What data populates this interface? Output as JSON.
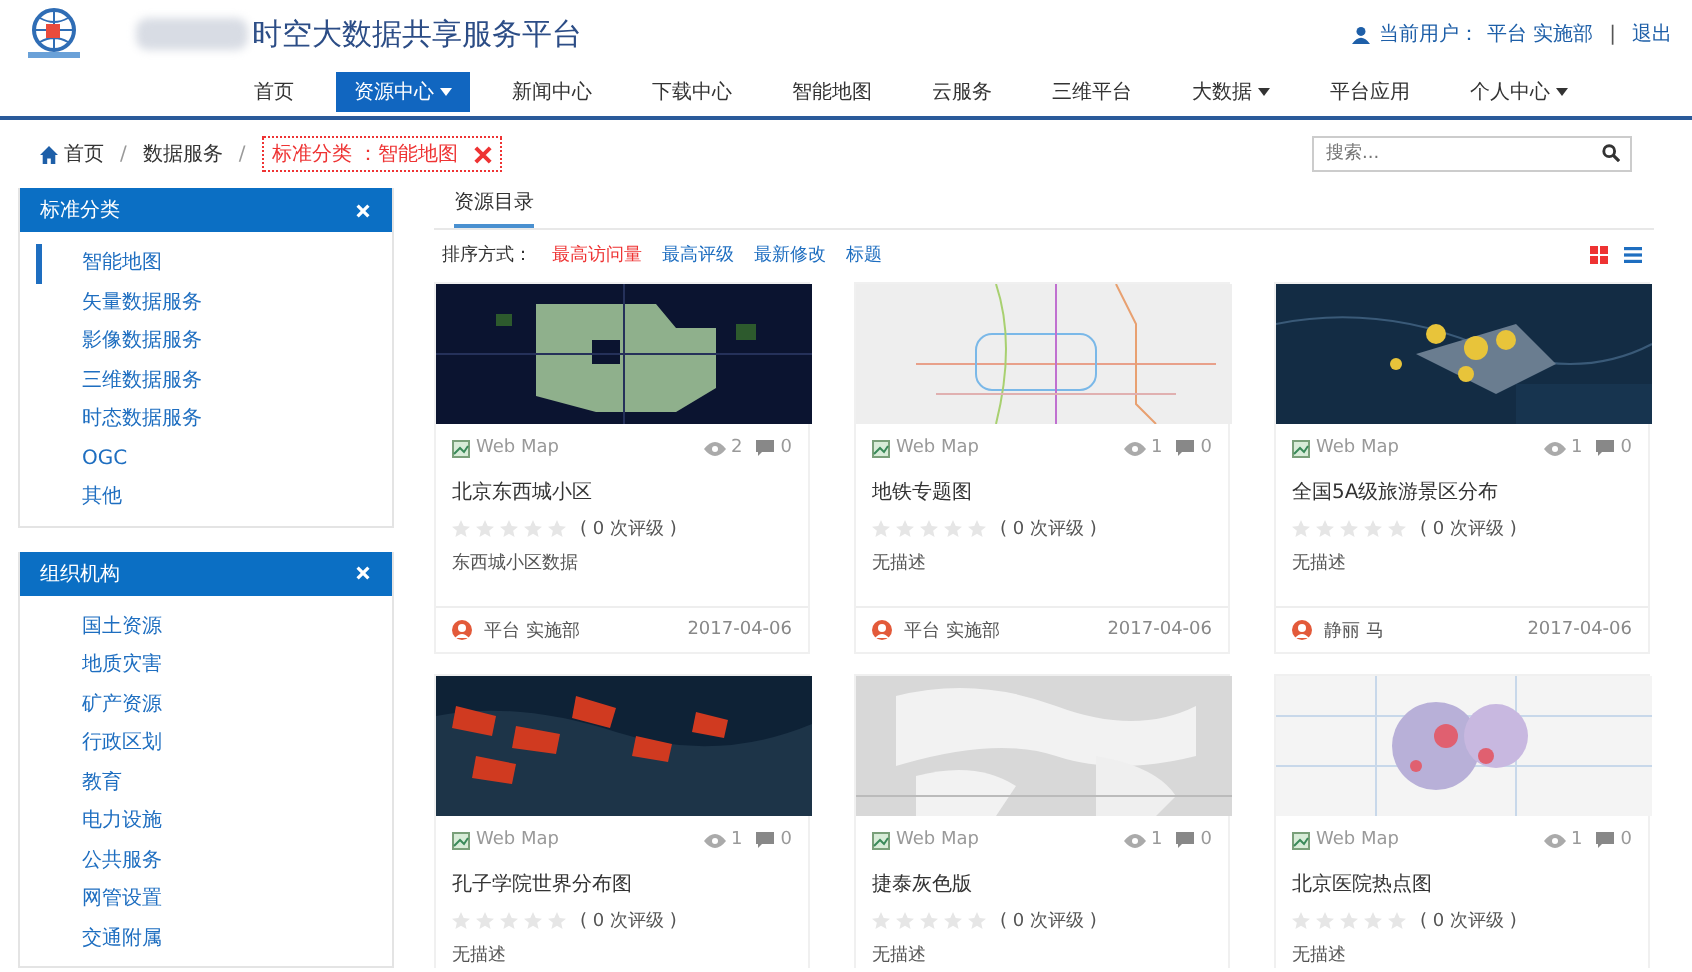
{
  "header": {
    "title": "时空大数据共享服务平台",
    "user_label": "当前用户：",
    "user_name": "平台 实施部",
    "separator": "|",
    "logout": "退出"
  },
  "nav": [
    {
      "label": "首页",
      "selected": false,
      "dropdown": false
    },
    {
      "label": "资源中心",
      "selected": true,
      "dropdown": true
    },
    {
      "label": "新闻中心",
      "selected": false,
      "dropdown": false
    },
    {
      "label": "下载中心",
      "selected": false,
      "dropdown": false
    },
    {
      "label": "智能地图",
      "selected": false,
      "dropdown": false
    },
    {
      "label": "云服务",
      "selected": false,
      "dropdown": false
    },
    {
      "label": "三维平台",
      "selected": false,
      "dropdown": false
    },
    {
      "label": "大数据",
      "selected": false,
      "dropdown": true
    },
    {
      "label": "平台应用",
      "selected": false,
      "dropdown": false
    },
    {
      "label": "个人中心",
      "selected": false,
      "dropdown": true
    }
  ],
  "breadcrumb": {
    "items": [
      "首页",
      "数据服务"
    ],
    "separator": "/",
    "filter": "标准分类 ：智能地图"
  },
  "search": {
    "placeholder": "搜索..."
  },
  "sidebar": [
    {
      "title": "标准分类",
      "items": [
        {
          "label": "智能地图",
          "selected": true
        },
        {
          "label": "矢量数据服务",
          "selected": false
        },
        {
          "label": "影像数据服务",
          "selected": false
        },
        {
          "label": "三维数据服务",
          "selected": false
        },
        {
          "label": "时态数据服务",
          "selected": false
        },
        {
          "label": "OGC",
          "selected": false
        },
        {
          "label": "其他",
          "selected": false
        }
      ]
    },
    {
      "title": "组织机构",
      "items": [
        {
          "label": "国土资源",
          "selected": false
        },
        {
          "label": "地质灾害",
          "selected": false
        },
        {
          "label": "矿产资源",
          "selected": false
        },
        {
          "label": "行政区划",
          "selected": false
        },
        {
          "label": "教育",
          "selected": false
        },
        {
          "label": "电力设施",
          "selected": false
        },
        {
          "label": "公共服务",
          "selected": false
        },
        {
          "label": "网管设置",
          "selected": false
        },
        {
          "label": "交通附属",
          "selected": false
        }
      ]
    }
  ],
  "content": {
    "tab": "资源目录",
    "sort_label": "排序方式：",
    "sort_options": [
      {
        "label": "最高访问量",
        "selected": true
      },
      {
        "label": "最高评级",
        "selected": false
      },
      {
        "label": "最新修改",
        "selected": false
      },
      {
        "label": "标题",
        "selected": false
      }
    ],
    "views": [
      {
        "kind": "grid",
        "selected": true
      },
      {
        "kind": "list",
        "selected": false
      }
    ]
  },
  "cards": [
    {
      "type": "Web Map",
      "views": "2",
      "comments": "0",
      "title": "北京东西城小区",
      "stars": 0,
      "ratings": "( 0 次评级 )",
      "description": "东西城小区数据",
      "author": "平台 实施部",
      "date": "2017-04-06"
    },
    {
      "type": "Web Map",
      "views": "1",
      "comments": "0",
      "title": "地铁专题图",
      "stars": 0,
      "ratings": "( 0 次评级 )",
      "description": "无描述",
      "author": "平台 实施部",
      "date": "2017-04-06"
    },
    {
      "type": "Web Map",
      "views": "1",
      "comments": "0",
      "title": "全国5A级旅游景区分布",
      "stars": 0,
      "ratings": "( 0 次评级 )",
      "description": "无描述",
      "author": "静丽 马",
      "date": "2017-04-06"
    },
    {
      "type": "Web Map",
      "views": "1",
      "comments": "0",
      "title": "孔子学院世界分布图",
      "stars": 0,
      "ratings": "( 0 次评级 )",
      "description": "无描述"
    },
    {
      "type": "Web Map",
      "views": "1",
      "comments": "0",
      "title": "捷泰灰色版",
      "stars": 0,
      "ratings": "( 0 次评级 )",
      "description": "无描述"
    },
    {
      "type": "Web Map",
      "views": "1",
      "comments": "0",
      "title": "北京医院热点图",
      "stars": 0,
      "ratings": "( 0 次评级 )",
      "description": "无描述"
    }
  ]
}
